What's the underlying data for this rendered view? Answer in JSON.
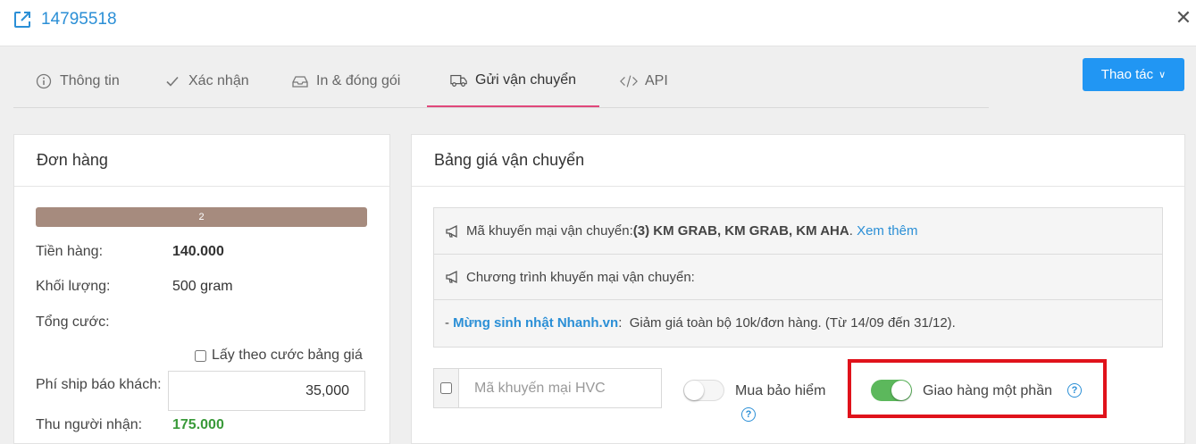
{
  "header": {
    "order_id": "14795518",
    "close_symbol": "✕"
  },
  "tabs": [
    {
      "label": "Thông tin",
      "icon": "info-icon"
    },
    {
      "label": "Xác nhận",
      "icon": "check-icon"
    },
    {
      "label": "In & đóng gói",
      "icon": "inbox-icon"
    },
    {
      "label": "Gửi vận chuyển",
      "icon": "truck-icon",
      "active": true
    },
    {
      "label": "API",
      "icon": "code-icon"
    }
  ],
  "action_button": {
    "label": "Thao tác",
    "chevron": "∨"
  },
  "order_card": {
    "title": "Đơn hàng",
    "progress_label": "2",
    "rows": {
      "goods_label": "Tiền hàng:",
      "goods_value": "140.000",
      "weight_label": "Khối lượng:",
      "weight_value": "500 gram",
      "total_label": "Tổng cước:",
      "use_price_table_label": "Lấy theo cước bảng giá",
      "ship_fee_label": "Phí ship báo khách:",
      "ship_fee_value": "35,000",
      "receiver_label": "Thu người nhận:",
      "receiver_value": "175.000"
    }
  },
  "shipping_card": {
    "title": "Bảng giá vận chuyển",
    "promo_code_prefix": "Mã khuyến mại vận chuyển: ",
    "promo_code_count": "(3)",
    "promo_codes": "KM GRAB, KM GRAB, KM AHA",
    "promo_code_suffix": ".",
    "see_more": "Xem thêm",
    "promo_program_label": "Chương trình khuyến mại vận chuyển:",
    "program_dash": "- ",
    "program_name": "Mừng sinh nhật Nhanh.vn",
    "program_colon": ":",
    "program_desc": "Giảm giá toàn bộ 10k/đơn hàng. (Từ 14/09 đến 31/12).",
    "hvc_placeholder": "Mã khuyến mại HVC",
    "insurance_label": "Mua bảo hiểm",
    "partial_delivery_label": "Giao hàng một phần",
    "help_symbol": "?"
  }
}
